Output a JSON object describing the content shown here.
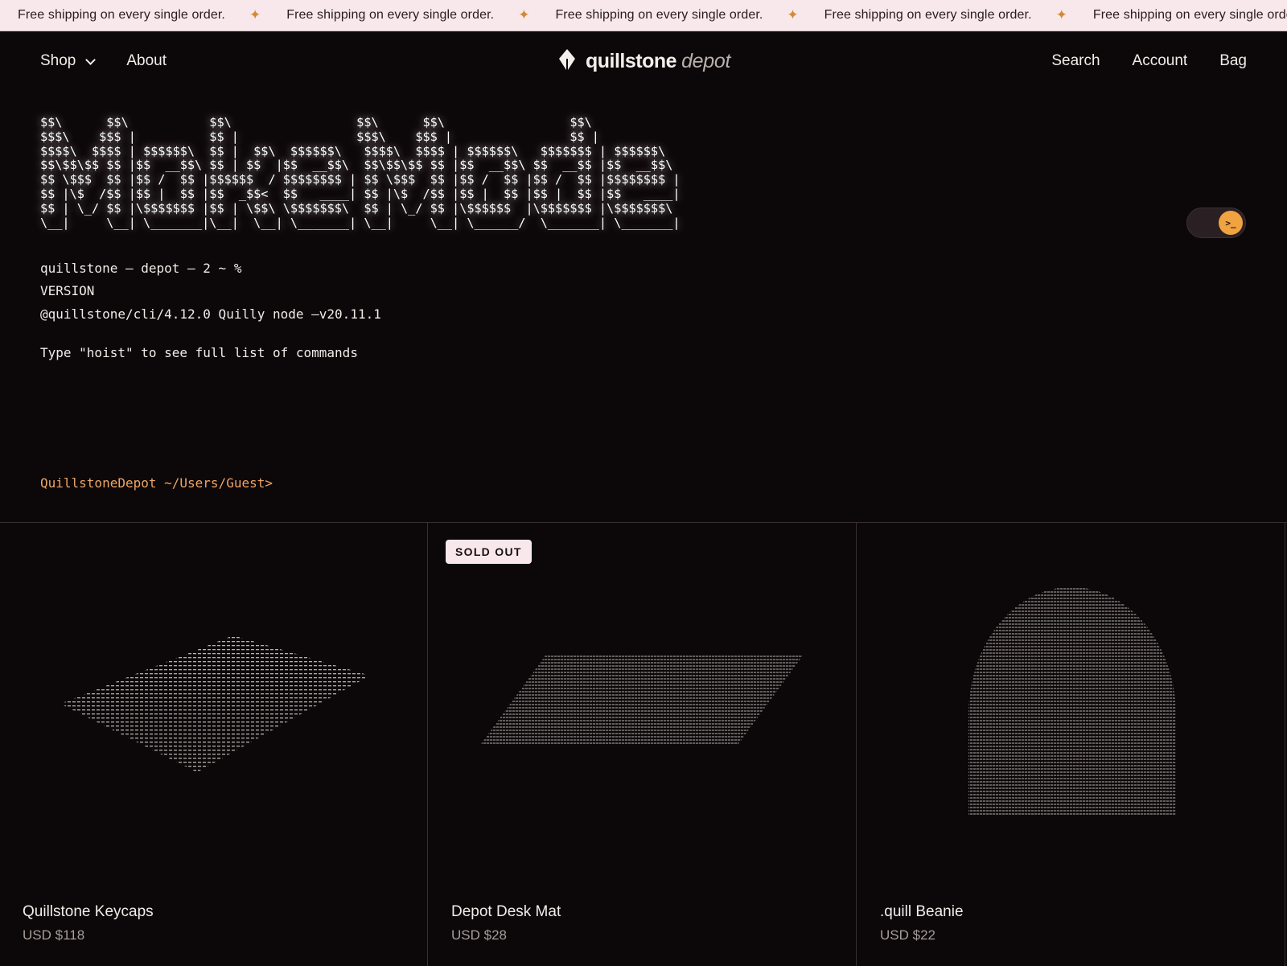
{
  "banner": {
    "messages": [
      "Free shipping on every single order.",
      "Free shipping on every single order.",
      "Free shipping on every single order.",
      "Free shipping on every single order.",
      "Free shipping on every single order."
    ]
  },
  "header": {
    "nav_left": [
      "Shop",
      "About"
    ],
    "logo_main": "quillstone",
    "logo_sub": "depot",
    "nav_right": [
      "Search",
      "Account",
      "Bag"
    ]
  },
  "terminal": {
    "ascii_art": "$$\\      $$\\           $$\\                 $$\\      $$\\                 $$\\\n$$$\\    $$$ |          $$ |                $$$\\    $$$ |                $$ |\n$$$$\\  $$$$ | $$$$$$\\  $$ |  $$\\  $$$$$$\\   $$$$\\  $$$$ | $$$$$$\\   $$$$$$$ | $$$$$$\\\n$$\\$$\\$$ $$ |$$  __$$\\ $$ | $$  |$$  __$$\\  $$\\$$\\$$ $$ |$$  __$$\\ $$  __$$ |$$  __$$\\\n$$ \\$$$  $$ |$$ /  $$ |$$$$$$  / $$$$$$$$ | $$ \\$$$  $$ |$$ /  $$ |$$ /  $$ |$$$$$$$$ |\n$$ |\\$  /$$ |$$ |  $$ |$$  _$$<  $$   ____| $$ |\\$  /$$ |$$ |  $$ |$$ |  $$ |$$   ____|\n$$ | \\_/ $$ |\\$$$$$$$ |$$ | \\$$\\ \\$$$$$$$\\  $$ | \\_/ $$ |\\$$$$$$  |\\$$$$$$$ |\\$$$$$$$\\\n\\__|     \\__| \\_______|\\__|  \\__| \\_______| \\__|     \\__| \\______/  \\_______| \\_______|",
    "lines": [
      "quillstone — depot — 2 ~ %",
      "VERSION",
      "@quillstone/cli/4.12.0 Quilly node –v20.11.1",
      "Type \"hoist\" to see full list of commands"
    ],
    "prompt": "QuillstoneDepot ~/Users/Guest>",
    "toggle_glyph": ">_"
  },
  "products": [
    {
      "name": "Quillstone Keycaps",
      "price": "USD $118",
      "badge": "",
      "icon": "keycaps-ascii-art"
    },
    {
      "name": "Depot Desk Mat",
      "price": "USD $28",
      "badge": "SOLD OUT",
      "icon": "desk-mat-ascii-art"
    },
    {
      "name": ".quill Beanie",
      "price": "USD $22",
      "badge": "",
      "icon": "beanie-ascii-art"
    }
  ],
  "colors": {
    "background": "#0c0709",
    "banner_bg": "#f8e8eb",
    "accent_orange": "#f0a340",
    "prompt_orange": "#eea564",
    "star": "#d28a35"
  }
}
